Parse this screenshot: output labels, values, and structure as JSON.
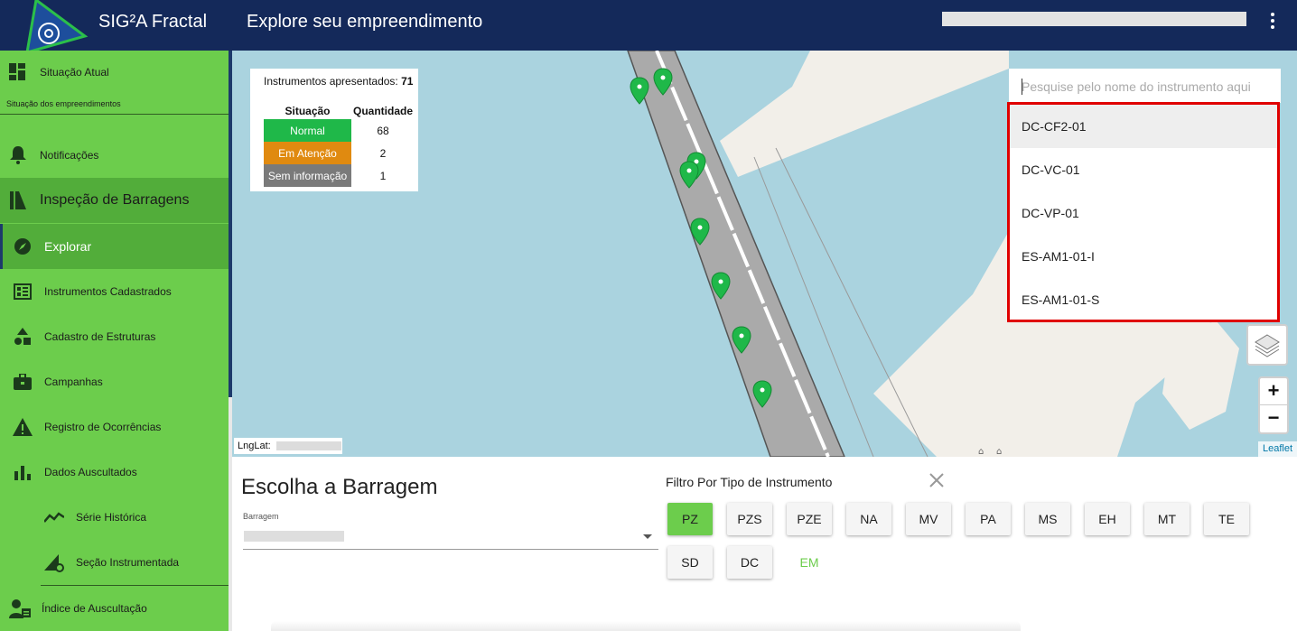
{
  "header": {
    "app_title": "SIG²A Fractal",
    "page_title": "Explore seu empreendimento"
  },
  "sidebar": {
    "current_status": "Situação Atual",
    "current_status_sub": "Situação dos empreendimentos",
    "notifications": "Notificações",
    "section": "Inspeção de Barragens",
    "items": [
      {
        "label": "Explorar",
        "icon": "compass-icon"
      },
      {
        "label": "Instrumentos Cadastrados",
        "icon": "instrument-panel-icon"
      },
      {
        "label": "Cadastro de Estruturas",
        "icon": "shapes-icon"
      },
      {
        "label": "Campanhas",
        "icon": "briefcase-icon"
      },
      {
        "label": "Registro de Ocorrências",
        "icon": "warning-icon"
      },
      {
        "label": "Dados Auscultados",
        "icon": "bar-chart-icon"
      },
      {
        "label": "Série Histórica",
        "icon": "trend-line-icon"
      },
      {
        "label": "Seção Instrumentada",
        "icon": "section-gear-icon"
      },
      {
        "label": "Índice de Auscultação",
        "icon": "worker-icon"
      }
    ]
  },
  "legend": {
    "title_prefix": "Instrumentos apresentados:",
    "total": "71",
    "col_status": "Situação",
    "col_qty": "Quantidade",
    "rows": [
      {
        "status": "Normal",
        "qty": "68",
        "color": "#1fb849"
      },
      {
        "status": "Em Atenção",
        "qty": "2",
        "color": "#e08a10"
      },
      {
        "status": "Sem informação",
        "qty": "1",
        "color": "#7a7a7a"
      }
    ]
  },
  "search": {
    "placeholder": "Pesquise pelo nome do instrumento aqui",
    "results": [
      "DC-CF2-01",
      "DC-VC-01",
      "DC-VP-01",
      "ES-AM1-01-I",
      "ES-AM1-01-S"
    ]
  },
  "map": {
    "lnglat_label": "LngLat:",
    "attribution": "Leaflet",
    "zoom_in": "+",
    "zoom_out": "−",
    "marker_color": "#1fb849"
  },
  "dam": {
    "title": "Escolha a Barragem",
    "field_label": "Barragem"
  },
  "filter": {
    "title": "Filtro Por Tipo de Instrumento",
    "types": [
      "PZ",
      "PZS",
      "PZE",
      "NA",
      "MV",
      "PA",
      "MS",
      "EH",
      "MT",
      "TE",
      "SD",
      "DC",
      "EM"
    ],
    "active": "PZ"
  }
}
